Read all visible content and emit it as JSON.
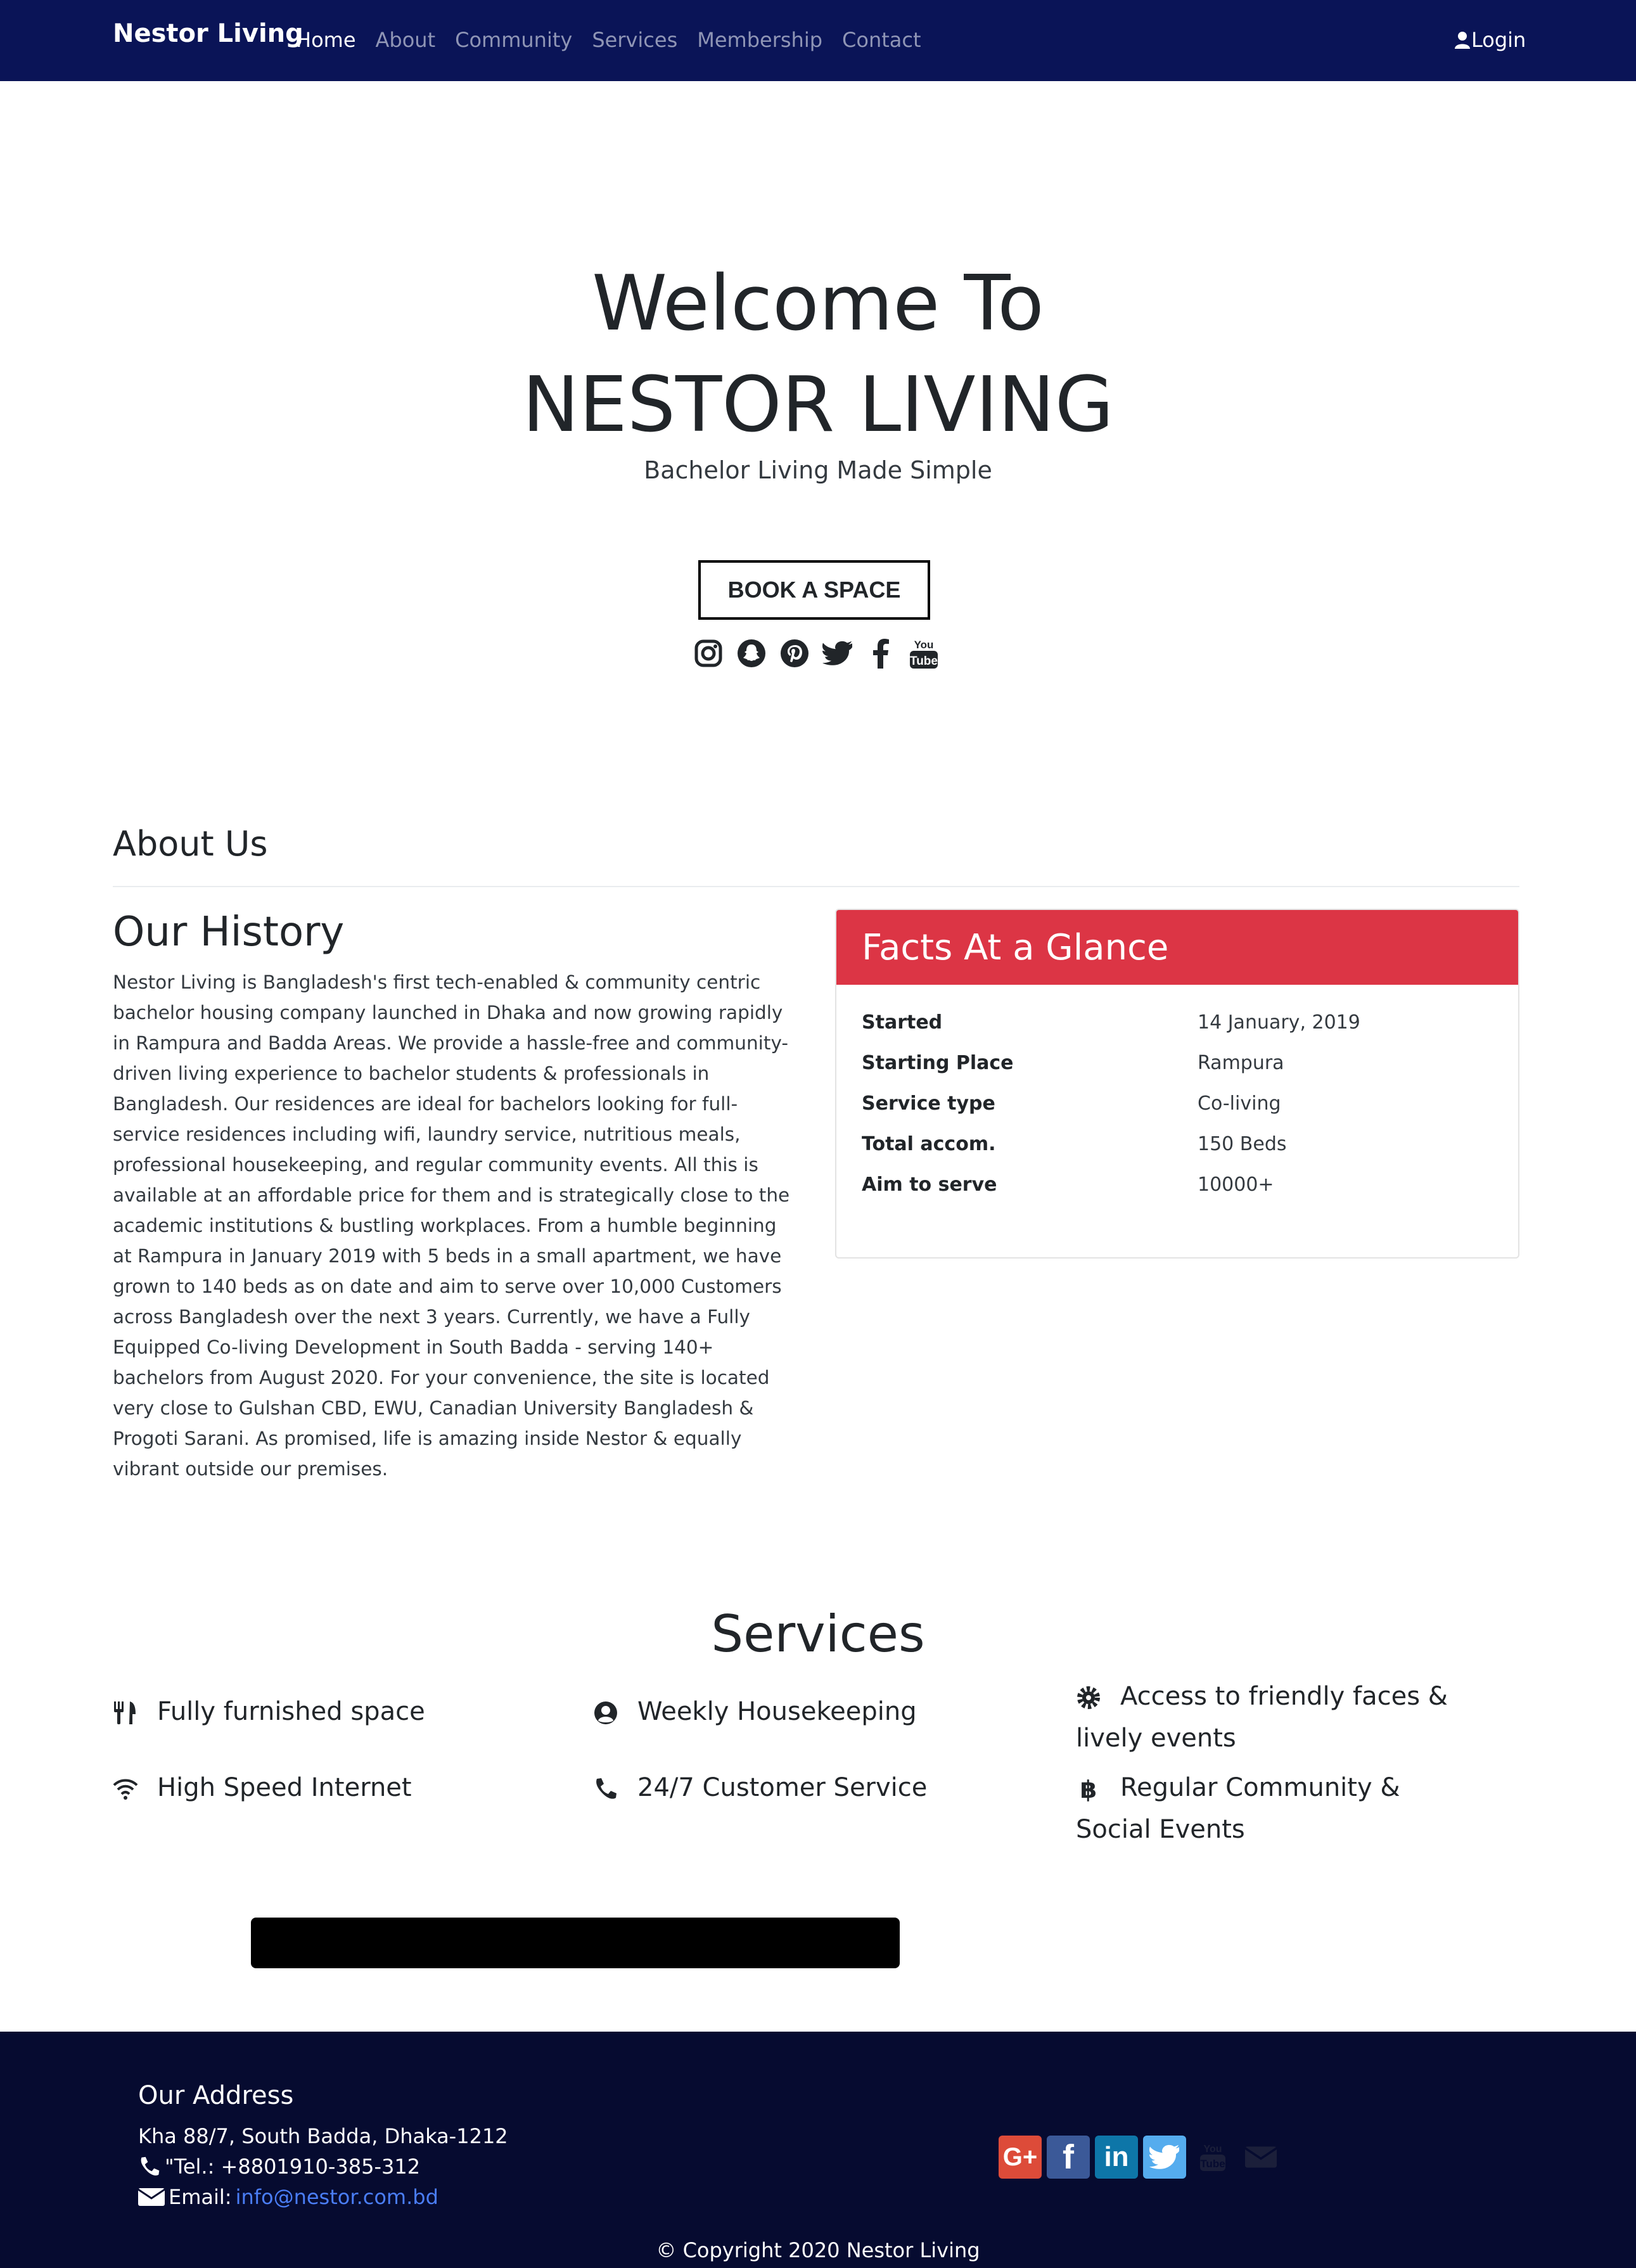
{
  "navbar": {
    "brand": "Nestor Living",
    "links": [
      "Home",
      "About",
      "Community",
      "Services",
      "Membership",
      "Contact"
    ],
    "active": "Home",
    "login": "Login"
  },
  "hero": {
    "title_line1": "Welcome To",
    "title_line2": "NESTOR LIVING",
    "subtitle": "Bachelor Living Made Simple",
    "cta": "BOOK A SPACE",
    "social_icons": [
      "instagram-icon",
      "snapchat-icon",
      "pinterest-icon",
      "twitter-icon",
      "facebook-icon",
      "youtube-icon"
    ]
  },
  "about": {
    "heading": "About Us",
    "history_title": "Our History",
    "history_text": "Nestor Living is Bangladesh's first tech-enabled & community centric bachelor housing company launched in Dhaka and now growing rapidly in Rampura and Badda Areas. We provide a hassle-free and community-driven living experience to bachelor students & professionals in Bangladesh. Our residences are ideal for bachelors looking for full-service residences including wifi, laundry service, nutritious meals, professional housekeeping, and regular community events. All this is available at an affordable price for them and is strategically close to the academic institutions & bustling workplaces. From a humble beginning at Rampura in January 2019 with 5 beds in a small apartment, we have grown to 140 beds as on date and aim to serve over 10,000 Customers across Bangladesh over the next 3 years. Currently, we have a Fully Equipped Co-living Development in South Badda - serving 140+ bachelors from August 2020. For your convenience, the site is located very close to Gulshan CBD, EWU, Canadian University Bangladesh & Progoti Sarani. As promised, life is amazing inside Nestor & equally vibrant outside our premises.",
    "facts_title": "Facts At a Glance",
    "facts": [
      {
        "key": "Started",
        "value": "14 January, 2019"
      },
      {
        "key": "Starting Place",
        "value": "Rampura"
      },
      {
        "key": "Service type",
        "value": "Co-living"
      },
      {
        "key": "Total accom.",
        "value": "150 Beds"
      },
      {
        "key": "Aim to serve",
        "value": "10000+"
      }
    ],
    "facts_color": "#dc3545"
  },
  "services": {
    "heading": "Services",
    "items": [
      {
        "label": "Fully furnished space",
        "icon": "utensils-icon"
      },
      {
        "label": "Weekly Housekeeping",
        "icon": "user-circle-icon"
      },
      {
        "label": "Access to friendly faces & lively events",
        "icon": "gear-icon"
      },
      {
        "label": "High Speed Internet",
        "icon": "wifi-icon"
      },
      {
        "label": "24/7 Customer Service",
        "icon": "phone-icon"
      },
      {
        "label": "Regular Community & Social Events",
        "icon": "bitcoin-icon"
      }
    ]
  },
  "footer": {
    "address_title": "Our Address",
    "address": "Kha 88/7, South Badda, Dhaka-1212",
    "tel": "\"Tel.: +8801910-385-312",
    "email_label": "Email:",
    "email": "info@nestor.com.bd",
    "social": [
      {
        "icon": "google-plus-icon",
        "glyph": "G+",
        "color": "#dd4b39"
      },
      {
        "icon": "facebook-icon",
        "glyph": "f",
        "color": "#3b5998"
      },
      {
        "icon": "linkedin-icon",
        "glyph": "in",
        "color": "#0e76a8"
      },
      {
        "icon": "twitter-icon",
        "glyph": "🐦",
        "color": "#55acee"
      },
      {
        "icon": "youtube-icon",
        "glyph": "You",
        "color": "transparent"
      },
      {
        "icon": "envelope-icon",
        "glyph": "✉",
        "color": "transparent"
      }
    ],
    "copyright": "© Copyright 2020 Nestor Living"
  },
  "colors": {
    "navbar_bg": "#0a1457",
    "footer_bg": "#060b30",
    "link": "#4a7df5"
  }
}
